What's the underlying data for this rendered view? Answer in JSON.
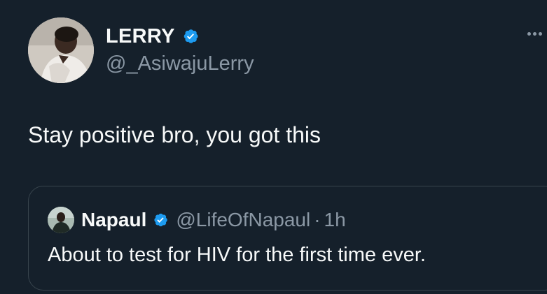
{
  "colors": {
    "background": "#15202b",
    "text_primary": "#f7f9f9",
    "text_secondary": "#8b98a5",
    "verified_blue": "#1d9bf0",
    "border": "#38444d"
  },
  "author": {
    "display_name": "LERRY",
    "handle": "@_AsiwajuLerry",
    "verified": true,
    "avatar_icon": "user-avatar"
  },
  "tweet": {
    "text": "Stay positive bro, you got this"
  },
  "more_icon": "more-horizontal-icon",
  "quoted_tweet": {
    "display_name": "Napaul",
    "handle": "@LifeOfNapaul",
    "separator": "·",
    "time": "1h",
    "verified": true,
    "text": "About to test for HIV for the first time ever."
  }
}
